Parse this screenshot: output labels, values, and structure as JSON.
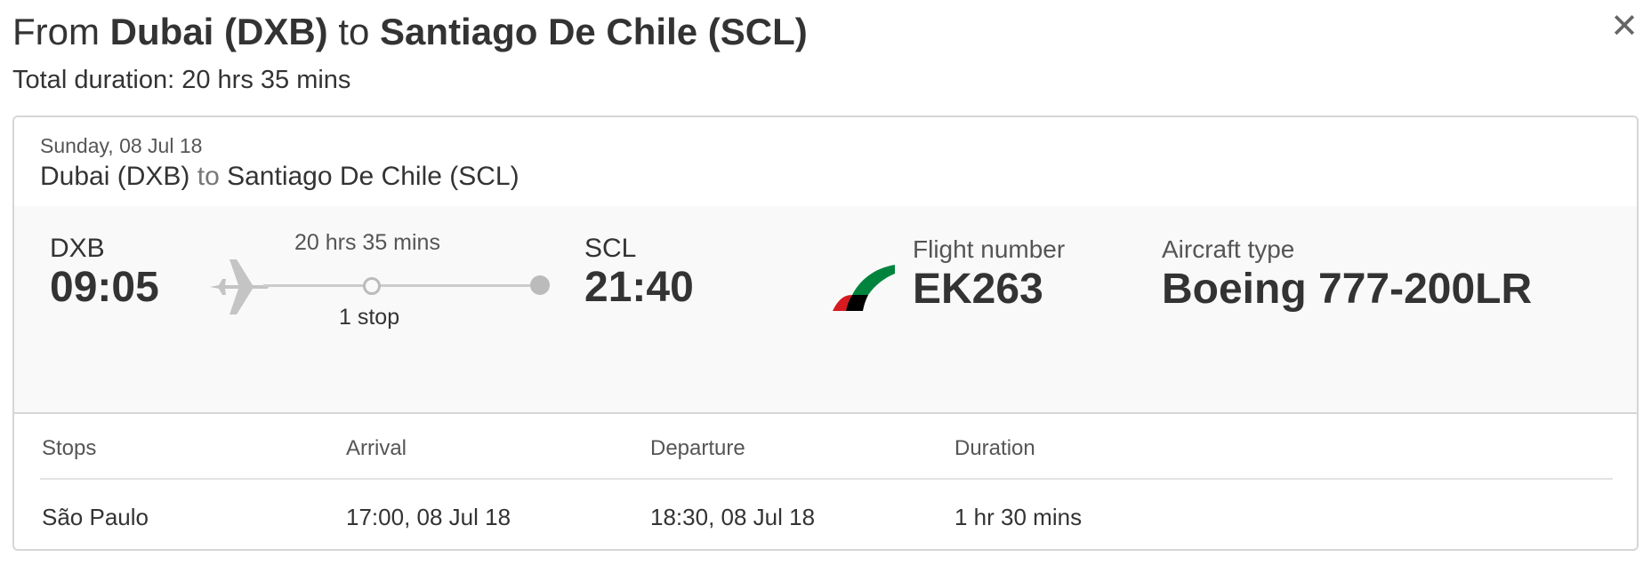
{
  "header": {
    "from_word": "From",
    "origin": "Dubai (DXB)",
    "to_word": "to",
    "destination": "Santiago De Chile (SCL)",
    "total_duration": "Total duration: 20 hrs 35 mins",
    "close_label": "✕"
  },
  "segment": {
    "date": "Sunday, 08 Jul 18",
    "route_origin": "Dubai (DXB)",
    "route_to_word": "to",
    "route_destination": "Santiago De Chile (SCL)",
    "dep_code": "DXB",
    "dep_time": "09:05",
    "duration": "20 hrs 35 mins",
    "stops": "1 stop",
    "arr_code": "SCL",
    "arr_time": "21:40",
    "flight_number_label": "Flight number",
    "flight_number": "EK263",
    "aircraft_label": "Aircraft type",
    "aircraft": "Boeing 777-200LR"
  },
  "stops_table": {
    "headers": [
      "Stops",
      "Arrival",
      "Departure",
      "Duration"
    ],
    "rows": [
      [
        "São Paulo",
        "17:00, 08 Jul 18",
        "18:30, 08 Jul 18",
        "1 hr 30 mins"
      ]
    ]
  },
  "icons": {
    "plane": "airplane-icon",
    "airline_logo": "emirates-logo",
    "close": "close-icon"
  },
  "colors": {
    "logo_green": "#00843d",
    "logo_red": "#d71920",
    "logo_black": "#000000",
    "track_grey": "#bbbbbb"
  }
}
